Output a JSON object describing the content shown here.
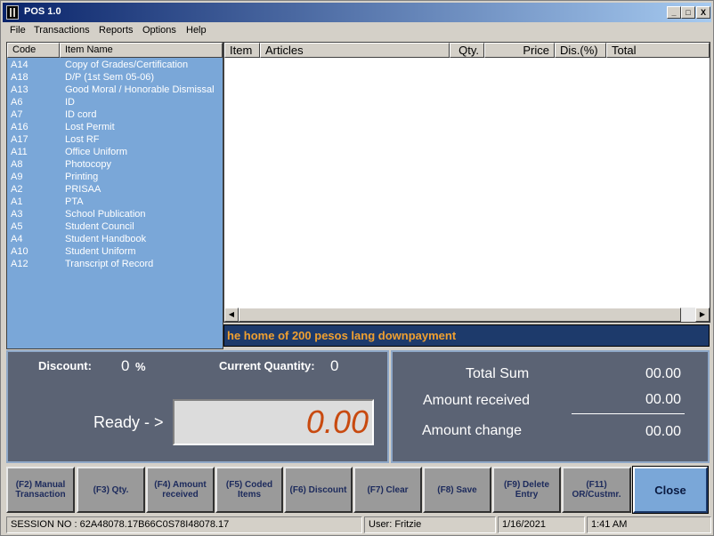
{
  "window": {
    "title": "POS 1.0",
    "minimize": "_",
    "maximize": "□",
    "close": "X"
  },
  "menu": [
    "File",
    "Transactions",
    "Reports",
    "Options",
    "Help"
  ],
  "item_list": {
    "headers": {
      "code": "Code",
      "name": "Item Name"
    },
    "rows": [
      {
        "code": "A14",
        "name": "Copy of Grades/Certification"
      },
      {
        "code": "A18",
        "name": "D/P (1st Sem 05-06)"
      },
      {
        "code": "A13",
        "name": "Good Moral / Honorable Dismissal"
      },
      {
        "code": "A6",
        "name": "ID"
      },
      {
        "code": "A7",
        "name": "ID cord"
      },
      {
        "code": "A16",
        "name": "Lost Permit"
      },
      {
        "code": "A17",
        "name": "Lost RF"
      },
      {
        "code": "A11",
        "name": "Office Uniform"
      },
      {
        "code": "A8",
        "name": "Photocopy"
      },
      {
        "code": "A9",
        "name": "Printing"
      },
      {
        "code": "A2",
        "name": "PRISAA"
      },
      {
        "code": "A1",
        "name": "PTA"
      },
      {
        "code": "A3",
        "name": "School Publication"
      },
      {
        "code": "A5",
        "name": "Student Council"
      },
      {
        "code": "A4",
        "name": "Student Handbook"
      },
      {
        "code": "A10",
        "name": "Student Uniform"
      },
      {
        "code": "A12",
        "name": "Transcript of Record"
      }
    ]
  },
  "articles": {
    "headers": {
      "item": "Item",
      "articles": "Articles",
      "qty": "Qty.",
      "price": "Price",
      "discount": "Dis.(%)",
      "total": "Total"
    },
    "scroll_left": "◀",
    "scroll_right": "▶"
  },
  "marquee": "he home of 200 pesos lang downpayment",
  "info": {
    "discount_label": "Discount:",
    "discount_value": "0",
    "discount_unit": "%",
    "quantity_label": "Current Quantity:",
    "quantity_value": "0",
    "ready_label": "Ready - >",
    "amount": "0.00"
  },
  "totals": {
    "total_sum_label": "Total Sum",
    "total_sum": "00.00",
    "received_label": "Amount received",
    "received": "00.00",
    "change_label": "Amount change",
    "change": "00.00"
  },
  "buttons": {
    "manual": "(F2) Manual Transaction",
    "qty": "(F3) Qty.",
    "amount": "(F4) Amount received",
    "coded": "(F5) Coded Items",
    "discount": "(F6) Discount",
    "clear": "(F7) Clear",
    "save": "(F8) Save",
    "delete": "(F9) Delete Entry",
    "or_customer": "(F11) OR/Custmr.",
    "close": "Close"
  },
  "status": {
    "session": "SESSION NO : 62A48078.17B66C0S78I48078.17",
    "user": "User: Fritzie",
    "date": "1/16/2021",
    "time": "1:41 AM"
  }
}
